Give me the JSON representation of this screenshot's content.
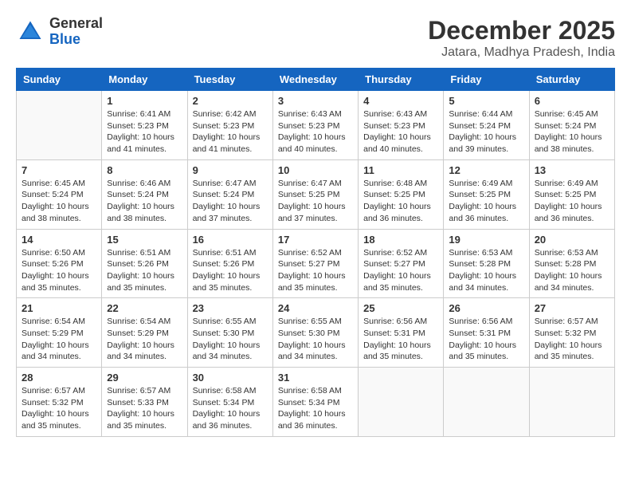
{
  "logo": {
    "general": "General",
    "blue": "Blue"
  },
  "header": {
    "month": "December 2025",
    "location": "Jatara, Madhya Pradesh, India"
  },
  "days_of_week": [
    "Sunday",
    "Monday",
    "Tuesday",
    "Wednesday",
    "Thursday",
    "Friday",
    "Saturday"
  ],
  "weeks": [
    [
      {
        "day": "",
        "info": ""
      },
      {
        "day": "1",
        "info": "Sunrise: 6:41 AM\nSunset: 5:23 PM\nDaylight: 10 hours and 41 minutes."
      },
      {
        "day": "2",
        "info": "Sunrise: 6:42 AM\nSunset: 5:23 PM\nDaylight: 10 hours and 41 minutes."
      },
      {
        "day": "3",
        "info": "Sunrise: 6:43 AM\nSunset: 5:23 PM\nDaylight: 10 hours and 40 minutes."
      },
      {
        "day": "4",
        "info": "Sunrise: 6:43 AM\nSunset: 5:23 PM\nDaylight: 10 hours and 40 minutes."
      },
      {
        "day": "5",
        "info": "Sunrise: 6:44 AM\nSunset: 5:24 PM\nDaylight: 10 hours and 39 minutes."
      },
      {
        "day": "6",
        "info": "Sunrise: 6:45 AM\nSunset: 5:24 PM\nDaylight: 10 hours and 38 minutes."
      }
    ],
    [
      {
        "day": "7",
        "info": "Sunrise: 6:45 AM\nSunset: 5:24 PM\nDaylight: 10 hours and 38 minutes."
      },
      {
        "day": "8",
        "info": "Sunrise: 6:46 AM\nSunset: 5:24 PM\nDaylight: 10 hours and 38 minutes."
      },
      {
        "day": "9",
        "info": "Sunrise: 6:47 AM\nSunset: 5:24 PM\nDaylight: 10 hours and 37 minutes."
      },
      {
        "day": "10",
        "info": "Sunrise: 6:47 AM\nSunset: 5:25 PM\nDaylight: 10 hours and 37 minutes."
      },
      {
        "day": "11",
        "info": "Sunrise: 6:48 AM\nSunset: 5:25 PM\nDaylight: 10 hours and 36 minutes."
      },
      {
        "day": "12",
        "info": "Sunrise: 6:49 AM\nSunset: 5:25 PM\nDaylight: 10 hours and 36 minutes."
      },
      {
        "day": "13",
        "info": "Sunrise: 6:49 AM\nSunset: 5:25 PM\nDaylight: 10 hours and 36 minutes."
      }
    ],
    [
      {
        "day": "14",
        "info": "Sunrise: 6:50 AM\nSunset: 5:26 PM\nDaylight: 10 hours and 35 minutes."
      },
      {
        "day": "15",
        "info": "Sunrise: 6:51 AM\nSunset: 5:26 PM\nDaylight: 10 hours and 35 minutes."
      },
      {
        "day": "16",
        "info": "Sunrise: 6:51 AM\nSunset: 5:26 PM\nDaylight: 10 hours and 35 minutes."
      },
      {
        "day": "17",
        "info": "Sunrise: 6:52 AM\nSunset: 5:27 PM\nDaylight: 10 hours and 35 minutes."
      },
      {
        "day": "18",
        "info": "Sunrise: 6:52 AM\nSunset: 5:27 PM\nDaylight: 10 hours and 35 minutes."
      },
      {
        "day": "19",
        "info": "Sunrise: 6:53 AM\nSunset: 5:28 PM\nDaylight: 10 hours and 34 minutes."
      },
      {
        "day": "20",
        "info": "Sunrise: 6:53 AM\nSunset: 5:28 PM\nDaylight: 10 hours and 34 minutes."
      }
    ],
    [
      {
        "day": "21",
        "info": "Sunrise: 6:54 AM\nSunset: 5:29 PM\nDaylight: 10 hours and 34 minutes."
      },
      {
        "day": "22",
        "info": "Sunrise: 6:54 AM\nSunset: 5:29 PM\nDaylight: 10 hours and 34 minutes."
      },
      {
        "day": "23",
        "info": "Sunrise: 6:55 AM\nSunset: 5:30 PM\nDaylight: 10 hours and 34 minutes."
      },
      {
        "day": "24",
        "info": "Sunrise: 6:55 AM\nSunset: 5:30 PM\nDaylight: 10 hours and 34 minutes."
      },
      {
        "day": "25",
        "info": "Sunrise: 6:56 AM\nSunset: 5:31 PM\nDaylight: 10 hours and 35 minutes."
      },
      {
        "day": "26",
        "info": "Sunrise: 6:56 AM\nSunset: 5:31 PM\nDaylight: 10 hours and 35 minutes."
      },
      {
        "day": "27",
        "info": "Sunrise: 6:57 AM\nSunset: 5:32 PM\nDaylight: 10 hours and 35 minutes."
      }
    ],
    [
      {
        "day": "28",
        "info": "Sunrise: 6:57 AM\nSunset: 5:32 PM\nDaylight: 10 hours and 35 minutes."
      },
      {
        "day": "29",
        "info": "Sunrise: 6:57 AM\nSunset: 5:33 PM\nDaylight: 10 hours and 35 minutes."
      },
      {
        "day": "30",
        "info": "Sunrise: 6:58 AM\nSunset: 5:34 PM\nDaylight: 10 hours and 36 minutes."
      },
      {
        "day": "31",
        "info": "Sunrise: 6:58 AM\nSunset: 5:34 PM\nDaylight: 10 hours and 36 minutes."
      },
      {
        "day": "",
        "info": ""
      },
      {
        "day": "",
        "info": ""
      },
      {
        "day": "",
        "info": ""
      }
    ]
  ]
}
